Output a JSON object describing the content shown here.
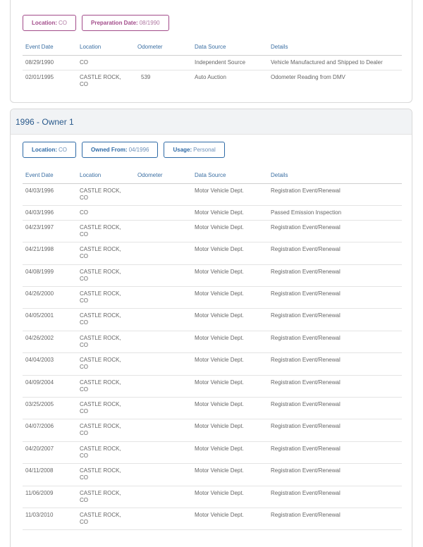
{
  "record1": {
    "badges": [
      {
        "label": "Location:",
        "value": "CO"
      },
      {
        "label": "Preparation Date:",
        "value": "08/1990"
      }
    ],
    "columns": [
      "Event Date",
      "Location",
      "Odometer",
      "Data Source",
      "Details"
    ],
    "rows": [
      {
        "date": "08/29/1990",
        "location": "CO",
        "odometer": "",
        "source": "Independent Source",
        "details": "Vehicle Manufactured and Shipped to Dealer"
      },
      {
        "date": "02/01/1995",
        "location": "CASTLE ROCK, CO",
        "odometer": "539",
        "source": "Auto Auction",
        "details": "Odometer Reading from DMV"
      }
    ]
  },
  "owner1": {
    "title": "1996 - Owner 1",
    "badges": [
      {
        "label": "Location:",
        "value": "CO"
      },
      {
        "label": "Owned From:",
        "value": "04/1996"
      },
      {
        "label": "Usage:",
        "value": "Personal"
      }
    ],
    "columns": [
      "Event Date",
      "Location",
      "Odometer",
      "Data Source",
      "Details"
    ],
    "rows": [
      {
        "date": "04/03/1996",
        "location": "CASTLE ROCK, CO",
        "odometer": "",
        "source": "Motor Vehicle Dept.",
        "details": "Registration Event/Renewal"
      },
      {
        "date": "04/03/1996",
        "location": "CO",
        "odometer": "",
        "source": "Motor Vehicle Dept.",
        "details": "Passed Emission Inspection"
      },
      {
        "date": "04/23/1997",
        "location": "CASTLE ROCK, CO",
        "odometer": "",
        "source": "Motor Vehicle Dept.",
        "details": "Registration Event/Renewal"
      },
      {
        "date": "04/21/1998",
        "location": "CASTLE ROCK, CO",
        "odometer": "",
        "source": "Motor Vehicle Dept.",
        "details": "Registration Event/Renewal"
      },
      {
        "date": "04/08/1999",
        "location": "CASTLE ROCK, CO",
        "odometer": "",
        "source": "Motor Vehicle Dept.",
        "details": "Registration Event/Renewal"
      },
      {
        "date": "04/26/2000",
        "location": "CASTLE ROCK, CO",
        "odometer": "",
        "source": "Motor Vehicle Dept.",
        "details": "Registration Event/Renewal"
      },
      {
        "date": "04/05/2001",
        "location": "CASTLE ROCK, CO",
        "odometer": "",
        "source": "Motor Vehicle Dept.",
        "details": "Registration Event/Renewal"
      },
      {
        "date": "04/26/2002",
        "location": "CASTLE ROCK, CO",
        "odometer": "",
        "source": "Motor Vehicle Dept.",
        "details": "Registration Event/Renewal"
      },
      {
        "date": "04/04/2003",
        "location": "CASTLE ROCK, CO",
        "odometer": "",
        "source": "Motor Vehicle Dept.",
        "details": "Registration Event/Renewal"
      },
      {
        "date": "04/09/2004",
        "location": "CASTLE ROCK, CO",
        "odometer": "",
        "source": "Motor Vehicle Dept.",
        "details": "Registration Event/Renewal"
      },
      {
        "date": "03/25/2005",
        "location": "CASTLE ROCK, CO",
        "odometer": "",
        "source": "Motor Vehicle Dept.",
        "details": "Registration Event/Renewal"
      },
      {
        "date": "04/07/2006",
        "location": "CASTLE ROCK, CO",
        "odometer": "",
        "source": "Motor Vehicle Dept.",
        "details": "Registration Event/Renewal"
      },
      {
        "date": "04/20/2007",
        "location": "CASTLE ROCK, CO",
        "odometer": "",
        "source": "Motor Vehicle Dept.",
        "details": "Registration Event/Renewal"
      },
      {
        "date": "04/11/2008",
        "location": "CASTLE ROCK, CO",
        "odometer": "",
        "source": "Motor Vehicle Dept.",
        "details": "Registration Event/Renewal"
      },
      {
        "date": "11/06/2009",
        "location": "CASTLE ROCK, CO",
        "odometer": "",
        "source": "Motor Vehicle Dept.",
        "details": "Registration Event/Renewal"
      },
      {
        "date": "11/03/2010",
        "location": "CASTLE ROCK, CO",
        "odometer": "",
        "source": "Motor Vehicle Dept.",
        "details": "Registration Event/Renewal"
      }
    ]
  }
}
